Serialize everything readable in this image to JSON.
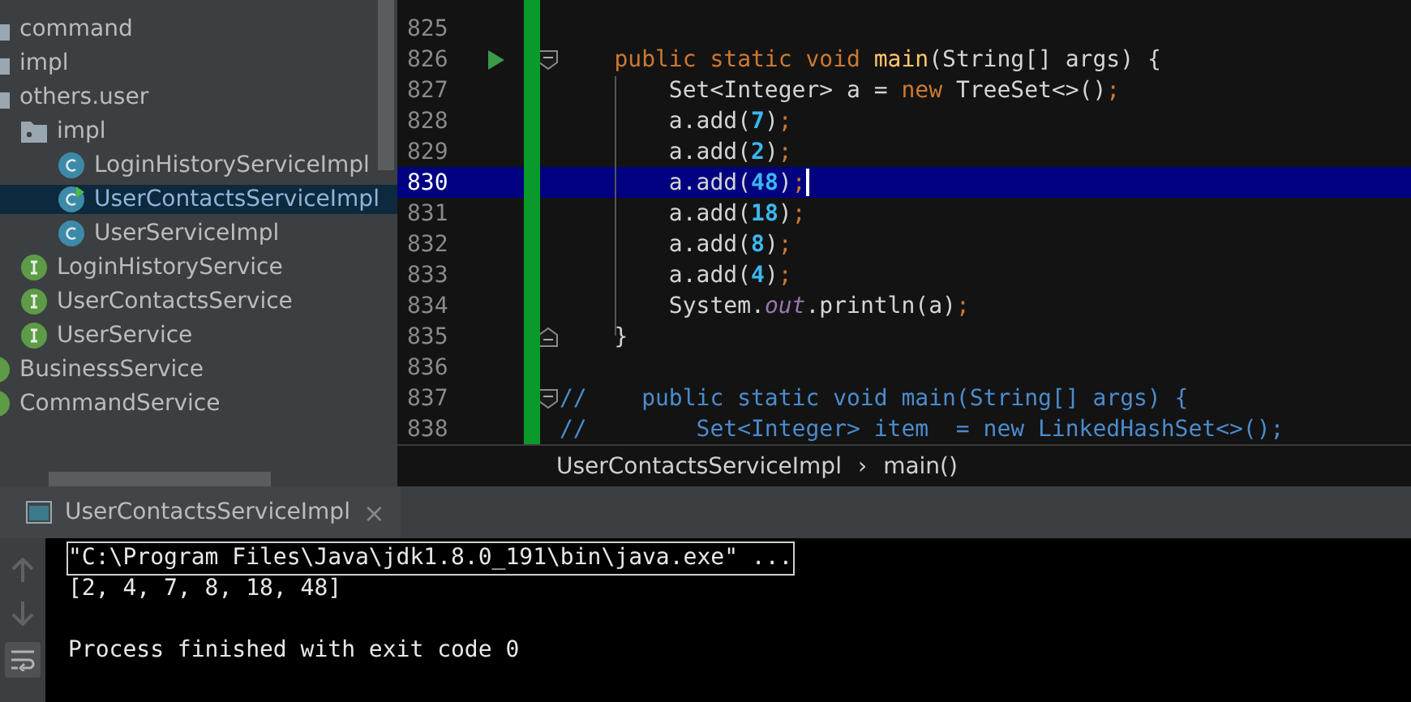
{
  "project_tree": [
    {
      "label": "command",
      "kind": "package",
      "selected": false,
      "runnable": false
    },
    {
      "label": "impl",
      "kind": "package",
      "selected": false,
      "runnable": false
    },
    {
      "label": "others.user",
      "kind": "package",
      "selected": false,
      "runnable": false,
      "children": [
        {
          "label": "impl",
          "kind": "folder",
          "selected": false,
          "runnable": false,
          "children": [
            {
              "label": "LoginHistoryServiceImpl",
              "kind": "class",
              "selected": false,
              "runnable": false
            },
            {
              "label": "UserContactsServiceImpl",
              "kind": "class",
              "selected": true,
              "runnable": true
            },
            {
              "label": "UserServiceImpl",
              "kind": "class",
              "selected": false,
              "runnable": false
            }
          ]
        },
        {
          "label": "LoginHistoryService",
          "kind": "interface",
          "selected": false,
          "runnable": false
        },
        {
          "label": "UserContactsService",
          "kind": "interface",
          "selected": false,
          "runnable": false
        },
        {
          "label": "UserService",
          "kind": "interface",
          "selected": false,
          "runnable": false
        }
      ]
    },
    {
      "label": "BusinessService",
      "kind": "interface",
      "selected": false,
      "runnable": false
    },
    {
      "label": "CommandService",
      "kind": "interface",
      "selected": false,
      "runnable": false
    }
  ],
  "editor": {
    "lines": [
      {
        "number": "825",
        "selected": false,
        "run": false,
        "fold_open": false,
        "fold_close": false
      },
      {
        "number": "826",
        "selected": false,
        "run": true,
        "fold_open": true,
        "fold_close": false,
        "tokens": [
          {
            "kind": "kw",
            "text": "    public static void "
          },
          {
            "kind": "fn",
            "text": "main"
          },
          {
            "kind": "txt",
            "text": "(String[] args) {"
          }
        ]
      },
      {
        "number": "827",
        "selected": false,
        "run": false,
        "fold_open": false,
        "fold_close": false,
        "tokens": [
          {
            "kind": "txt",
            "text": "        Set<Integer> a = "
          },
          {
            "kind": "kw",
            "text": "new "
          },
          {
            "kind": "txt",
            "text": "TreeSet<>()"
          },
          {
            "kind": "punct",
            "text": ";"
          }
        ]
      },
      {
        "number": "828",
        "selected": false,
        "run": false,
        "fold_open": false,
        "fold_close": false,
        "tokens": [
          {
            "kind": "txt",
            "text": "        a.add("
          },
          {
            "kind": "num",
            "text": "7"
          },
          {
            "kind": "txt",
            "text": ")"
          },
          {
            "kind": "punct",
            "text": ";"
          }
        ]
      },
      {
        "number": "829",
        "selected": false,
        "run": false,
        "fold_open": false,
        "fold_close": false,
        "tokens": [
          {
            "kind": "txt",
            "text": "        a.add("
          },
          {
            "kind": "num",
            "text": "2"
          },
          {
            "kind": "txt",
            "text": ")"
          },
          {
            "kind": "punct",
            "text": ";"
          }
        ]
      },
      {
        "number": "830",
        "selected": true,
        "run": false,
        "fold_open": false,
        "fold_close": false,
        "tokens": [
          {
            "kind": "txt",
            "text": "        a.add("
          },
          {
            "kind": "num",
            "text": "48"
          },
          {
            "kind": "txt",
            "text": ")"
          },
          {
            "kind": "punct",
            "text": ";"
          }
        ]
      },
      {
        "number": "831",
        "selected": false,
        "run": false,
        "fold_open": false,
        "fold_close": false,
        "tokens": [
          {
            "kind": "txt",
            "text": "        a.add("
          },
          {
            "kind": "num",
            "text": "18"
          },
          {
            "kind": "txt",
            "text": ")"
          },
          {
            "kind": "punct",
            "text": ";"
          }
        ]
      },
      {
        "number": "832",
        "selected": false,
        "run": false,
        "fold_open": false,
        "fold_close": false,
        "tokens": [
          {
            "kind": "txt",
            "text": "        a.add("
          },
          {
            "kind": "num",
            "text": "8"
          },
          {
            "kind": "txt",
            "text": ")"
          },
          {
            "kind": "punct",
            "text": ";"
          }
        ]
      },
      {
        "number": "833",
        "selected": false,
        "run": false,
        "fold_open": false,
        "fold_close": false,
        "tokens": [
          {
            "kind": "txt",
            "text": "        a.add("
          },
          {
            "kind": "num",
            "text": "4"
          },
          {
            "kind": "txt",
            "text": ")"
          },
          {
            "kind": "punct",
            "text": ";"
          }
        ]
      },
      {
        "number": "834",
        "selected": false,
        "run": false,
        "fold_open": false,
        "fold_close": false,
        "tokens": [
          {
            "kind": "txt",
            "text": "        System."
          },
          {
            "kind": "field",
            "text": "out"
          },
          {
            "kind": "txt",
            "text": ".println(a)"
          },
          {
            "kind": "punct",
            "text": ";"
          }
        ]
      },
      {
        "number": "835",
        "selected": false,
        "run": false,
        "fold_open": false,
        "fold_close": true,
        "tokens": [
          {
            "kind": "txt",
            "text": "    }"
          }
        ]
      },
      {
        "number": "836",
        "selected": false,
        "run": false,
        "fold_open": false,
        "fold_close": false
      },
      {
        "number": "837",
        "selected": false,
        "run": false,
        "fold_open": true,
        "fold_close": false,
        "tokens": [
          {
            "kind": "comment",
            "text": "//    public static void main(String[] args) {"
          }
        ]
      },
      {
        "number": "838",
        "selected": false,
        "run": false,
        "fold_open": false,
        "fold_close": false,
        "tokens": [
          {
            "kind": "comment",
            "text": "//        Set<Integer> item  = new LinkedHashSet<>();"
          }
        ]
      }
    ],
    "breadcrumbs": [
      "UserContactsServiceImpl",
      "›",
      "main()"
    ]
  },
  "run_panel": {
    "tab": {
      "label": "UserContactsServiceImpl",
      "close": "×"
    },
    "console_lines": [
      {
        "kind": "command",
        "text": "\"C:\\Program Files\\Java\\jdk1.8.0_191\\bin\\java.exe\" ..."
      },
      {
        "kind": "output",
        "text": "[2, 4, 7, 8, 18, 48]"
      },
      {
        "kind": "output",
        "text": "Process finished with exit code 0"
      }
    ]
  }
}
